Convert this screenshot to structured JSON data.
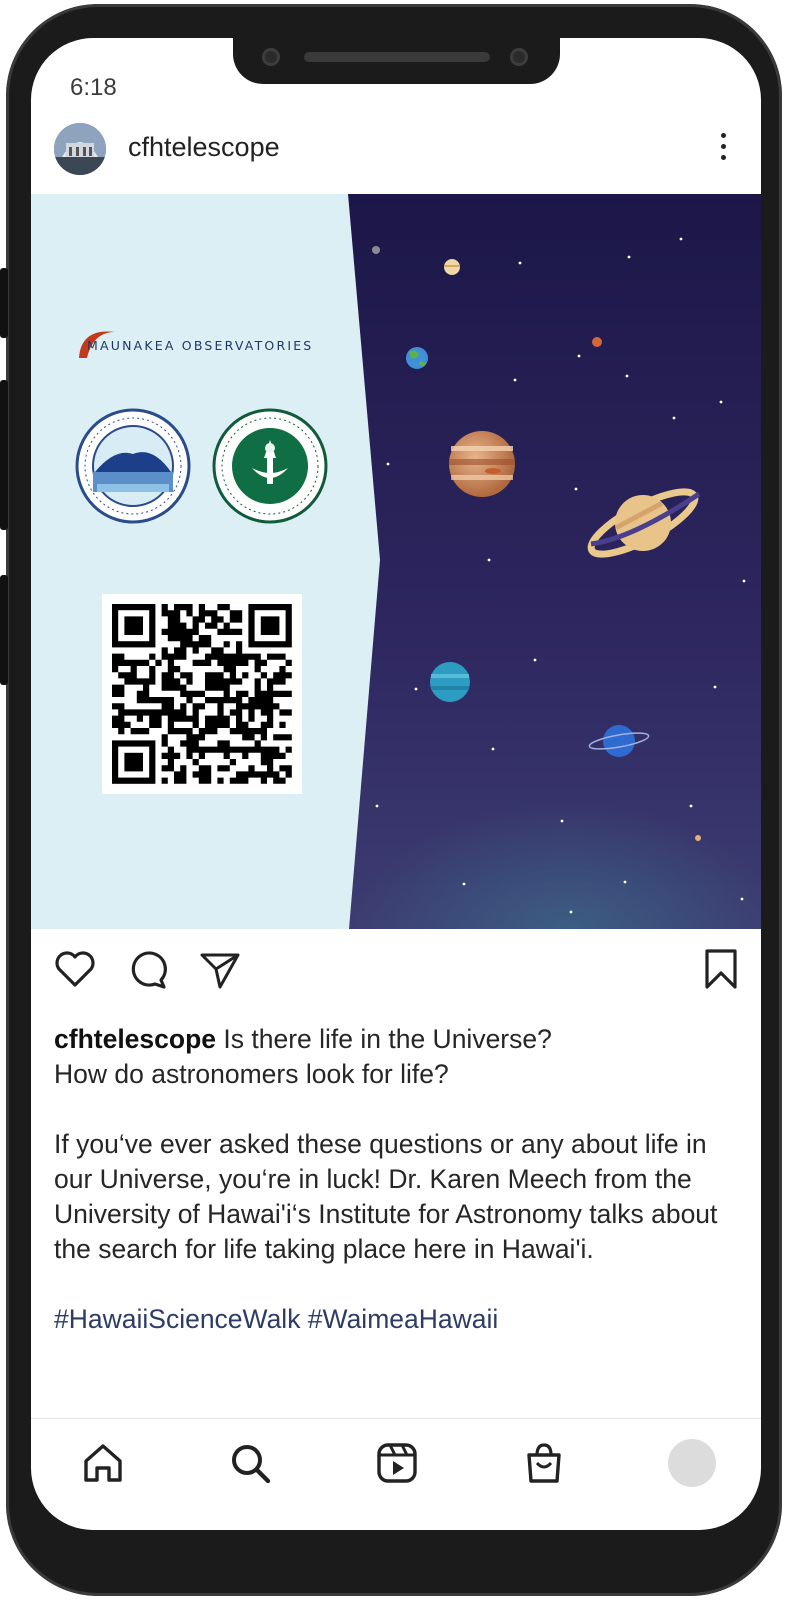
{
  "status_bar": {
    "time": "6:18"
  },
  "post": {
    "username": "cfhtelescope",
    "image": {
      "org_banner": "MAUNAKEA OBSERVATORIES",
      "ifa_seal_icon": "institute-for-astronomy-seal",
      "uh_seal_icon": "university-of-hawaii-seal",
      "qr_icon": "qr-code"
    },
    "actions": {
      "like_icon": "heart-icon",
      "comment_icon": "comment-icon",
      "share_icon": "send-icon",
      "save_icon": "bookmark-icon"
    },
    "caption": {
      "author": "cfhtelescope",
      "line1": "Is there life in the Universe?",
      "line2": "How do astronomers look for life?",
      "para1": "If you‘ve ever asked these questions or any about life in our Universe, you‘re in luck! Dr. Karen Meech from the University of Hawai'i‘s Institute for Astronomy talks about the search for life taking place here in Hawai'i.",
      "hashtags": "#HawaiiScienceWalk #WaimeaHawaii"
    }
  },
  "bottom_nav": [
    "home-icon",
    "search-icon",
    "reels-icon",
    "shop-icon",
    "profile-avatar"
  ],
  "colors": {
    "accent_hashtag": "#2d3c66",
    "panel": "#dceff5",
    "space_top": "#1c1748",
    "space_bottom": "#3e3a72"
  }
}
